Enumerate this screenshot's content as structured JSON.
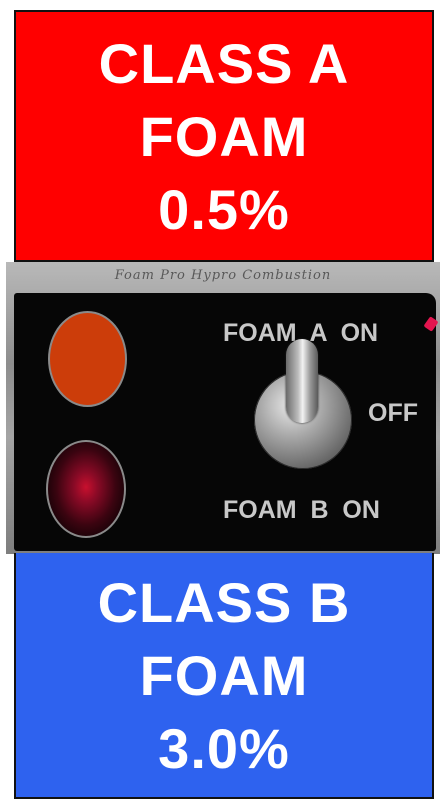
{
  "top_panel": {
    "line1": "CLASS A",
    "line2": "FOAM",
    "line3": "0.5%",
    "background_color": "#ff0000"
  },
  "switch_plate": {
    "label": "Foam Pro Hypro Combustion",
    "indicator_a": {
      "icon": "orange-indicator-light",
      "color": "#cc3d0a",
      "state": "on"
    },
    "indicator_b": {
      "icon": "red-indicator-light",
      "color": "#c8102e",
      "state": "dim"
    },
    "selector": {
      "icon": "toggle-lever-icon",
      "positions": [
        "FOAM  A  ON",
        "OFF",
        "FOAM  B  ON"
      ],
      "current": "FOAM  A  ON"
    },
    "labels": {
      "foam_a_on": "FOAM  A  ON",
      "off": "OFF",
      "foam_b_on": "FOAM  B  ON"
    },
    "marker_color": "#e3154f"
  },
  "bottom_panel": {
    "line1": "CLASS B",
    "line2": "FOAM",
    "line3": "3.0%",
    "background_color": "#2e62ef"
  }
}
